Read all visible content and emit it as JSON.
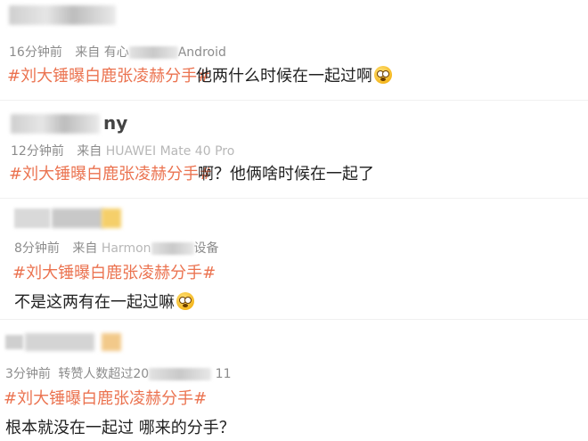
{
  "comments": [
    {
      "name_tail": "",
      "time": "16分钟前",
      "from_label": "来自",
      "source": "有心就…Android",
      "source_visible_prefix": "有心",
      "source_visible_suffix": "Android",
      "topic": "#刘大锤曝白鹿张凌赫分手#",
      "text": "他两什么时候在一起过啊",
      "has_emoji": true,
      "emoji_icon": "shocked-face-icon"
    },
    {
      "name_tail": "ny",
      "time": "12分钟前",
      "from_label": "来自",
      "source": "HUAWEI Mate 40 Pro",
      "source_visible_prefix": "HUAWEI",
      "source_visible_suffix": "Mate 40 Pro",
      "topic": "#刘大锤曝白鹿张凌赫分手#",
      "text": "啊？他俩啥时候在一起了",
      "has_emoji": false
    },
    {
      "name_tail": "",
      "time": "8分钟前",
      "from_label": "来自",
      "source_visible_prefix": "Harmon",
      "source_visible_suffix": "设备",
      "topic": "#刘大锤曝白鹿张凌赫分手#",
      "text": "不是这两有在一起过嘛",
      "has_emoji": true,
      "emoji_icon": "shocked-face-icon"
    },
    {
      "name_tail": "",
      "time": "3分钟前",
      "from_label": "转赞人数超过20",
      "source_visible_prefix": "转赞人数超过20",
      "source_visible_suffix": "11",
      "topic": "#刘大锤曝白鹿张凌赫分手#",
      "text": "根本就没在一起过 哪来的分手？",
      "has_emoji": false
    }
  ],
  "colors": {
    "topic": "#eb7350",
    "meta": "#8c8c8c",
    "text": "#222222",
    "emoji_face": "#f5b820"
  }
}
